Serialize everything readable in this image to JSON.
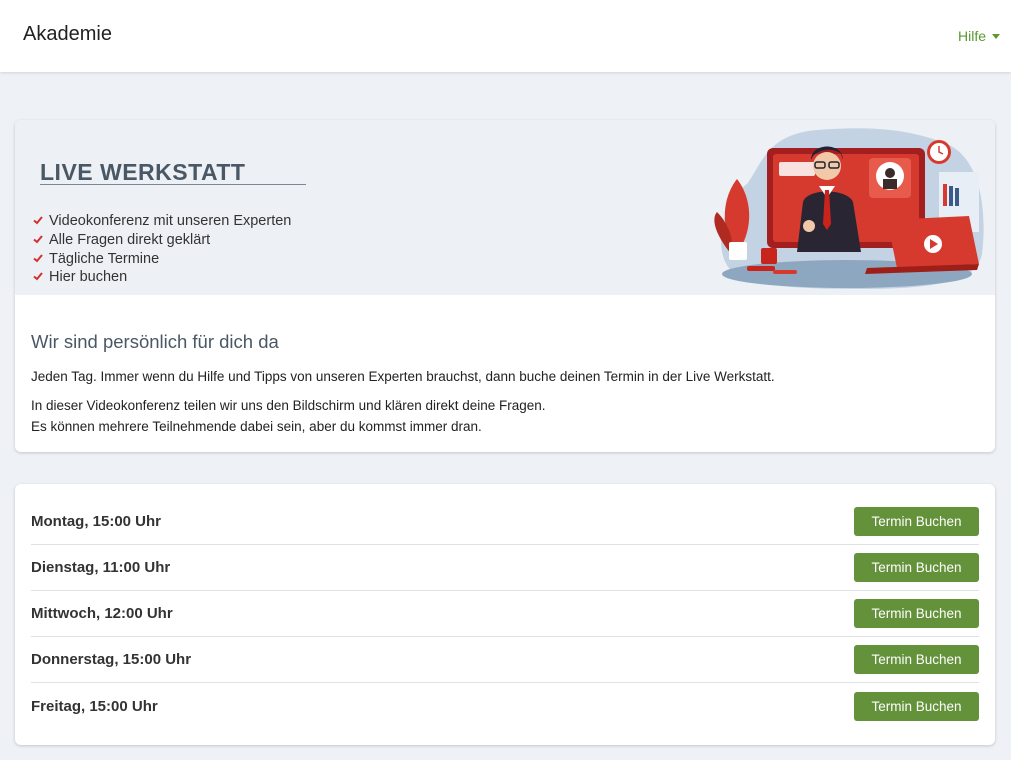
{
  "header": {
    "brand": "Akademie",
    "help_label": "Hilfe"
  },
  "hero": {
    "title": "LIVE WERKSTATT",
    "bullets": [
      "Videokonferenz mit unseren Experten",
      "Alle Fragen direkt geklärt",
      "Tägliche Termine",
      "Hier buchen"
    ]
  },
  "intro": {
    "heading": "Wir sind persönlich für dich da",
    "paragraph1": "Jeden Tag. Immer wenn du Hilfe und Tipps von unseren Experten brauchst, dann buche deinen Termin in der Live Werkstatt.",
    "paragraph2_line1": "In dieser Videokonferenz teilen wir uns den Bildschirm und klären direkt deine Fragen.",
    "paragraph2_line2": "Es können mehrere Teilnehmende dabei sein, aber du kommst immer dran."
  },
  "schedule": [
    {
      "label": "Montag, 15:00 Uhr",
      "button": "Termin Buchen"
    },
    {
      "label": "Dienstag, 11:00 Uhr",
      "button": "Termin Buchen"
    },
    {
      "label": "Mittwoch, 12:00 Uhr",
      "button": "Termin Buchen"
    },
    {
      "label": "Donnerstag, 15:00 Uhr",
      "button": "Termin Buchen"
    },
    {
      "label": "Freitag, 15:00 Uhr",
      "button": "Termin Buchen"
    }
  ],
  "colors": {
    "accent_green": "#63923a",
    "link_green": "#5a9a2f",
    "check_red": "#d32f2f",
    "heading_slate": "#4a5866"
  }
}
